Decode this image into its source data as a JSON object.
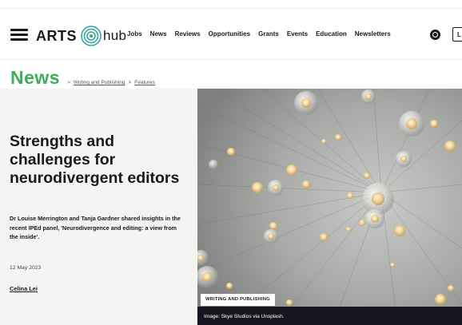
{
  "brand": {
    "arts": "ARTS",
    "hub": "hub"
  },
  "nav": [
    "Jobs",
    "News",
    "Reviews",
    "Opportunities",
    "Grants",
    "Events",
    "Education",
    "Newsletters"
  ],
  "login_label": "L",
  "section": {
    "title": "News",
    "breadcrumbs": [
      "Writing and Publishing",
      "Features"
    ]
  },
  "article": {
    "title": "Strengths and challenges for neurodivergent editors",
    "subtitle": "Dr Louise Merrington and Tanja Gardner shared insights in the recent IPEd panel, 'Neurodivergence and editing: a view from the inside'.",
    "date": "12 May 2023",
    "author": "Celina Lei",
    "tag": "WRITING AND PUBLISHING",
    "image_caption": "Image: Skye Studios via Unsplash."
  },
  "icons": {
    "menu": "hamburger-icon",
    "search": "search-icon",
    "logo": "arts-hub-logo-icon"
  },
  "colors": {
    "section_title": "#3dae5a",
    "caption_bar": "#15151e",
    "hero_left_bg": "#f4f4f2",
    "image_bg": "#9ea19f"
  }
}
